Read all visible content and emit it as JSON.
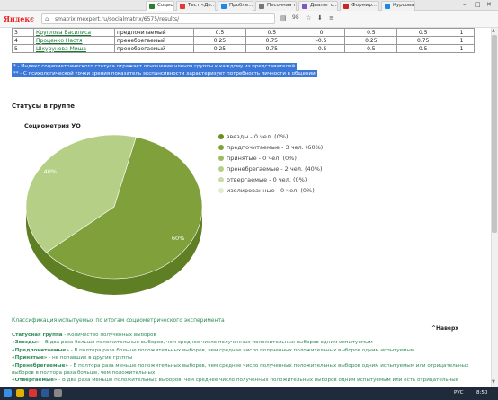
{
  "browser": {
    "tabs": [
      {
        "label": "Социом...",
        "active": true,
        "color": "#2e7d32"
      },
      {
        "label": "Тест «Де...",
        "active": false,
        "color": "#e53935"
      },
      {
        "label": "Пробле...",
        "active": false,
        "color": "#1e88e5"
      },
      {
        "label": "Песочная та...",
        "active": false,
        "color": "#777777"
      },
      {
        "label": "Диалог с...",
        "active": false,
        "color": "#7e57c2"
      },
      {
        "label": "Формир...",
        "active": false,
        "color": "#c62828"
      },
      {
        "label": "Курсовая...",
        "active": false,
        "color": "#1e88e5"
      }
    ],
    "brand": "Яндекс",
    "url": "smatrix.mexpert.ru/socialmatrix/6575/results/",
    "counter": "98"
  },
  "table": {
    "rows": [
      {
        "num": "3",
        "name": "Круглова Василиса",
        "status": "предпочитаемый",
        "c1": "0.5",
        "c2": "0.5",
        "c3": "0",
        "c4": "0.5",
        "c5": "0.5",
        "c6": "1"
      },
      {
        "num": "4",
        "name": "Проценко Настя",
        "status": "пренебрегаемый",
        "c1": "0.25",
        "c2": "0.75",
        "c3": "-0.5",
        "c4": "0.25",
        "c5": "0.75",
        "c6": "1"
      },
      {
        "num": "5",
        "name": "Шкурунова Миша",
        "status": "пренебрегаемый",
        "c1": "0.25",
        "c2": "0.75",
        "c3": "-0.5",
        "c4": "0.5",
        "c5": "0.5",
        "c6": "1"
      }
    ]
  },
  "notes": [
    "* - Индекс социометрического статуса отражает отношение членов группы к каждому из представителей",
    "** - С психологической точки зрения показатель экспансивности характеризует потребность личности в общении"
  ],
  "section_title": "Статусы в группе",
  "chart_data": {
    "type": "pie",
    "title": "Социометрия УО",
    "categories": [
      "звезды",
      "предпочитаемые",
      "принятые",
      "пренебрегаемые",
      "отвергаемые",
      "изолированные"
    ],
    "values": [
      0,
      60,
      0,
      40,
      0,
      0
    ],
    "slice_labels": [
      "",
      "60%",
      "",
      "40%",
      "",
      ""
    ],
    "colors": [
      "#6b8e23",
      "#7fa03a",
      "#9dbb5f",
      "#b5cf86",
      "#c8dca6",
      "#dfeccd"
    ],
    "legend": [
      "звезды - 0 чел. (0%)",
      "предпочитаемые - 3 чел. (60%)",
      "принятые - 0 чел. (0%)",
      "пренебрегаемые - 2 чел. (40%)",
      "отвергаемые - 0 чел. (0%)",
      "изолированные - 0 чел. (0%)"
    ],
    "legend_position": "right"
  },
  "classification": {
    "title": "Классификация испытуемых по итогам социометрического эксперимента",
    "back_link": "^Наверх",
    "defs": [
      {
        "term": "Статусная группа",
        "text": " - Количество полученных выборов"
      },
      {
        "term": "«Звезды»",
        "text": " - В два раза больше положительных выборов, чем среднее число полученных положительных выборов одним испытуемым"
      },
      {
        "term": "«Предпочитаемые»",
        "text": " - В полтора раза больше положительных выборов, чем среднее число полученных положительных выборов одним испытуемым"
      },
      {
        "term": "«Принятые»",
        "text": " - не попавшие в другие группы"
      },
      {
        "term": "«Пренебрегаемые»",
        "text": " - В полтора раза меньше положительных выборов, чем среднее число полученных положительных выборов одним испытуемым или отрицательных"
      },
      {
        "term": "",
        "text": "выборов в полтора раза больше, чем положительных"
      },
      {
        "term": "«Отвергаемые»",
        "text": " - В два раза меньше положительных выборов, чем среднее число полученных положительных выборов одним испытуемым или есть отрицательные"
      }
    ]
  },
  "taskbar": {
    "lang": "РУС",
    "time": "8:50"
  }
}
